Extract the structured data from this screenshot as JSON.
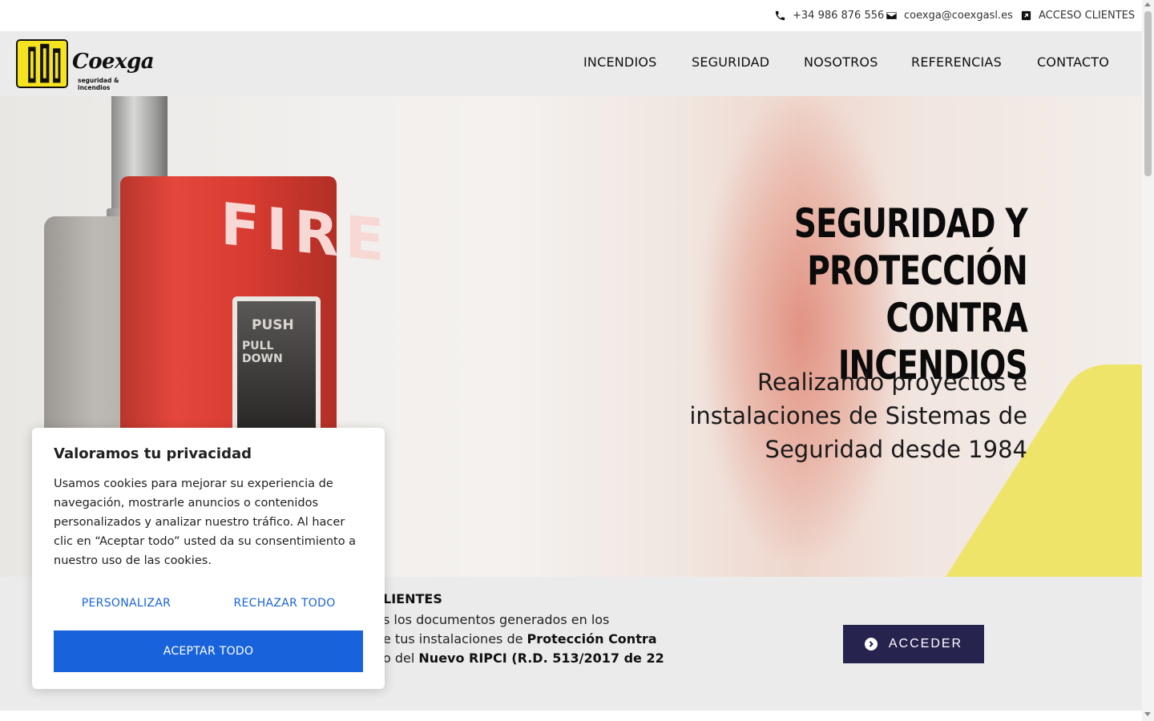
{
  "topbar": {
    "phone": "+34 986 876 556",
    "email": "coexga@coexgasl.es",
    "access": "ACCESO CLIENTES"
  },
  "brand": {
    "name": "Coexga",
    "tagline": "seguridad & incendios",
    "colors": {
      "yellow": "#f5e320",
      "navy": "#27234f",
      "cookie_blue": "#1863dc"
    }
  },
  "nav": {
    "items": [
      "INCENDIOS",
      "SEGURIDAD",
      "NOSOTROS",
      "REFERENCIAS",
      "CONTACTO"
    ]
  },
  "hero": {
    "heading_lines": [
      "SEGURIDAD Y",
      "PROTECCIÓN CONTRA",
      "INCENDIOS"
    ],
    "subheading_lines": [
      "Realizando proyectos e",
      "instalaciones de Sistemas de",
      "Seguridad desde 1984"
    ],
    "image_text": {
      "fire": "FIRE",
      "push": "PUSH",
      "pull": "PULL DOWN"
    }
  },
  "client_area": {
    "title": "LIENTES",
    "line1": "s los documentos generados en los",
    "line2_pre": "e tus instalaciones de ",
    "line2_bold": "Protección Contra",
    "line3_pre": "o del ",
    "line3_bold": "Nuevo RIPCI (R.D. 513/2017 de 22",
    "button": "ACCEDER"
  },
  "cookie": {
    "title": "Valoramos tu privacidad",
    "text": "Usamos cookies para mejorar su experiencia de navegación, mostrarle anuncios o contenidos personalizados y analizar nuestro tráfico. Al hacer clic en “Aceptar todo” usted da su consentimiento a nuestro uso de las cookies.",
    "customize": "PERSONALIZAR",
    "reject": "RECHAZAR TODO",
    "accept": "ACEPTAR TODO"
  },
  "icons": {
    "phone": "phone-icon",
    "email": "envelope-icon",
    "access": "external-link-icon",
    "acceder": "chevron-circle-right-icon"
  }
}
